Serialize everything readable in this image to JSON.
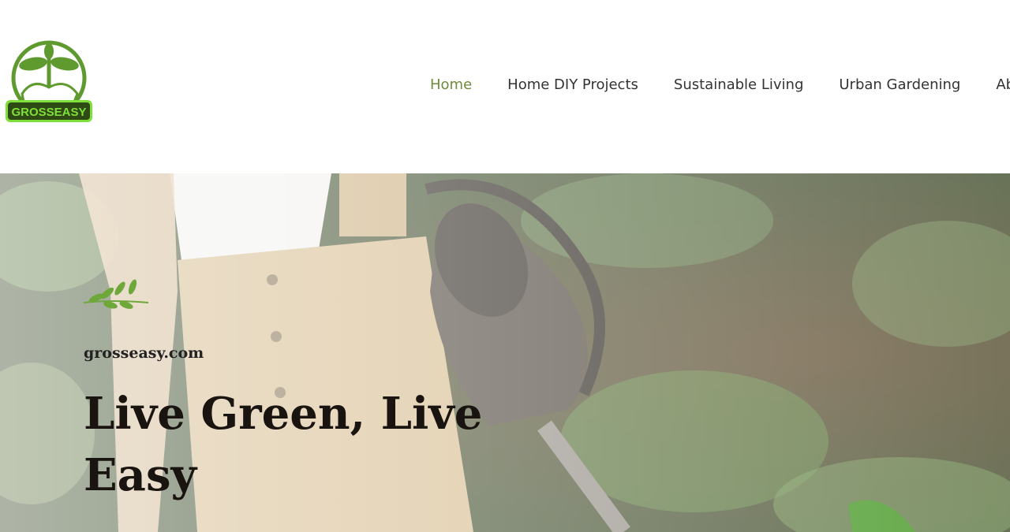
{
  "header": {
    "logo_text": "GROSSEASY",
    "nav": [
      {
        "label": "Home",
        "active": true
      },
      {
        "label": "Home DIY Projects",
        "active": false
      },
      {
        "label": "Sustainable Living",
        "active": false
      },
      {
        "label": "Urban Gardening",
        "active": false
      },
      {
        "label": "About",
        "active": false
      }
    ]
  },
  "hero": {
    "site_name": "grosseasy.com",
    "headline": "Live Green, Live Easy"
  },
  "colors": {
    "accent_green": "#6e8c3a",
    "logo_green": "#5e9a2e",
    "logo_lime": "#7fe03a",
    "text_dark": "#1a1410"
  }
}
